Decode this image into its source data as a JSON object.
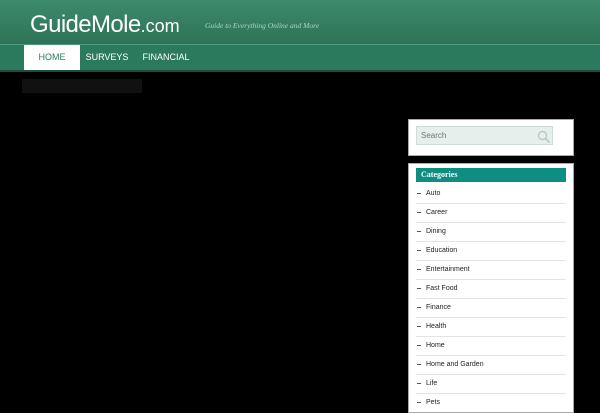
{
  "header": {
    "logo_main": "GuideMole",
    "logo_tld": ".com",
    "tagline": "Guide to Everything Online and More",
    "background": "#2e7357"
  },
  "nav": {
    "items": [
      {
        "label": "HOME",
        "active": true
      },
      {
        "label": "SURVEYS",
        "active": false
      },
      {
        "label": "FINANCIAL",
        "active": false
      }
    ]
  },
  "sidebar": {
    "search_placeholder": "Search",
    "categories_title": "Categories",
    "categories": [
      "Auto",
      "Career",
      "Dining",
      "Education",
      "Entertainment",
      "Fast Food",
      "Finance",
      "Health",
      "Home",
      "Home and Garden",
      "Life",
      "Pets"
    ]
  },
  "colors": {
    "accent": "#0e8e82",
    "nav_active_text": "#2f7e60",
    "page_background": "#000000"
  }
}
